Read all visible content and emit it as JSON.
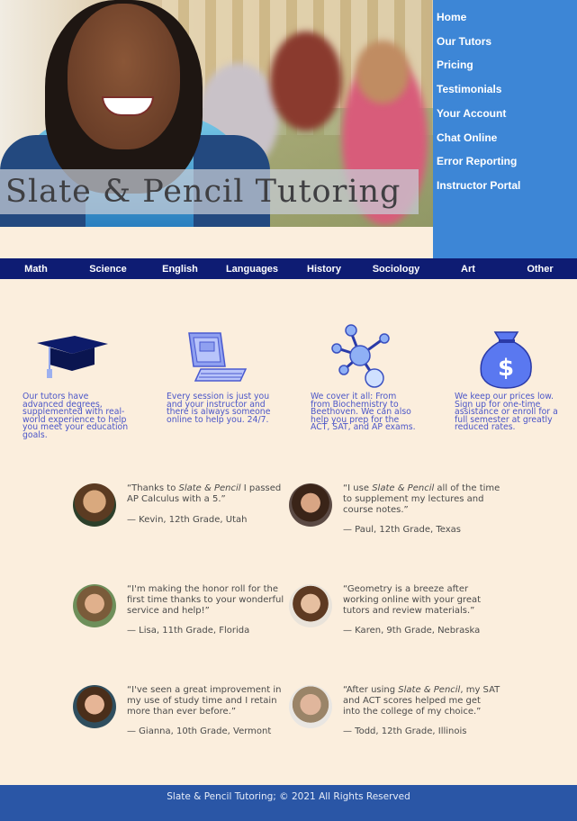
{
  "header": {
    "title": "Slate & Pencil Tutoring"
  },
  "topnav": {
    "items": [
      "Home",
      "Our Tutors",
      "Pricing",
      "Testimonials",
      "Your Account",
      "Chat Online",
      "Error Reporting",
      "Instructor Portal"
    ]
  },
  "subjects": {
    "items": [
      "Math",
      "Science",
      "English",
      "Languages",
      "History",
      "Sociology",
      "Art",
      "Other"
    ]
  },
  "features": [
    {
      "icon": "graduation-cap-icon",
      "text": "Our tutors have advanced degrees, supplemented with real-world experience to help you meet your education goals."
    },
    {
      "icon": "computer-icon",
      "text": "Every session is just you and your instructor and there is always someone online to help you. 24/7."
    },
    {
      "icon": "molecule-icon",
      "text": "We cover it all: From from Biochemistry to Beethoven. We can also help you prep for the ACT, SAT, and AP exams."
    },
    {
      "icon": "money-bag-icon",
      "text": "We keep our prices low. Sign up for one-time assistance or enroll for a full semester at greatly reduced rates."
    }
  ],
  "testimonials": [
    {
      "quote_pre": "“Thanks to ",
      "quote_em": "Slate & Pencil",
      "quote_post": " I passed AP Calculus with a 5.”",
      "author": "— Kevin, 12th Grade, Utah"
    },
    {
      "quote_pre": "“I use ",
      "quote_em": "Slate & Pencil",
      "quote_post": " all of the time to supplement my lectures and course notes.”",
      "author": "— Paul, 12th Grade, Texas"
    },
    {
      "quote_pre": "“I'm making the honor roll for the first time thanks to your wonderful service and help!”",
      "quote_em": "",
      "quote_post": "",
      "author": "— Lisa, 11th Grade, Florida"
    },
    {
      "quote_pre": "“Geometry is a breeze after working online with your great tutors and review materials.”",
      "quote_em": "",
      "quote_post": "",
      "author": "— Karen, 9th Grade, Nebraska"
    },
    {
      "quote_pre": "“I've seen a great improvement in my use of study time and I retain more than ever before.”",
      "quote_em": "",
      "quote_post": "",
      "author": "— Gianna, 10th Grade, Vermont"
    },
    {
      "quote_pre": "“After using ",
      "quote_em": "Slate & Pencil",
      "quote_post": ", my SAT and ACT scores helped me get into the college of my choice.”",
      "author": "— Todd, 12th Grade, Illinois"
    }
  ],
  "footer": {
    "text": "Slate & Pencil Tutoring; © 2021 All Rights Reserved"
  }
}
